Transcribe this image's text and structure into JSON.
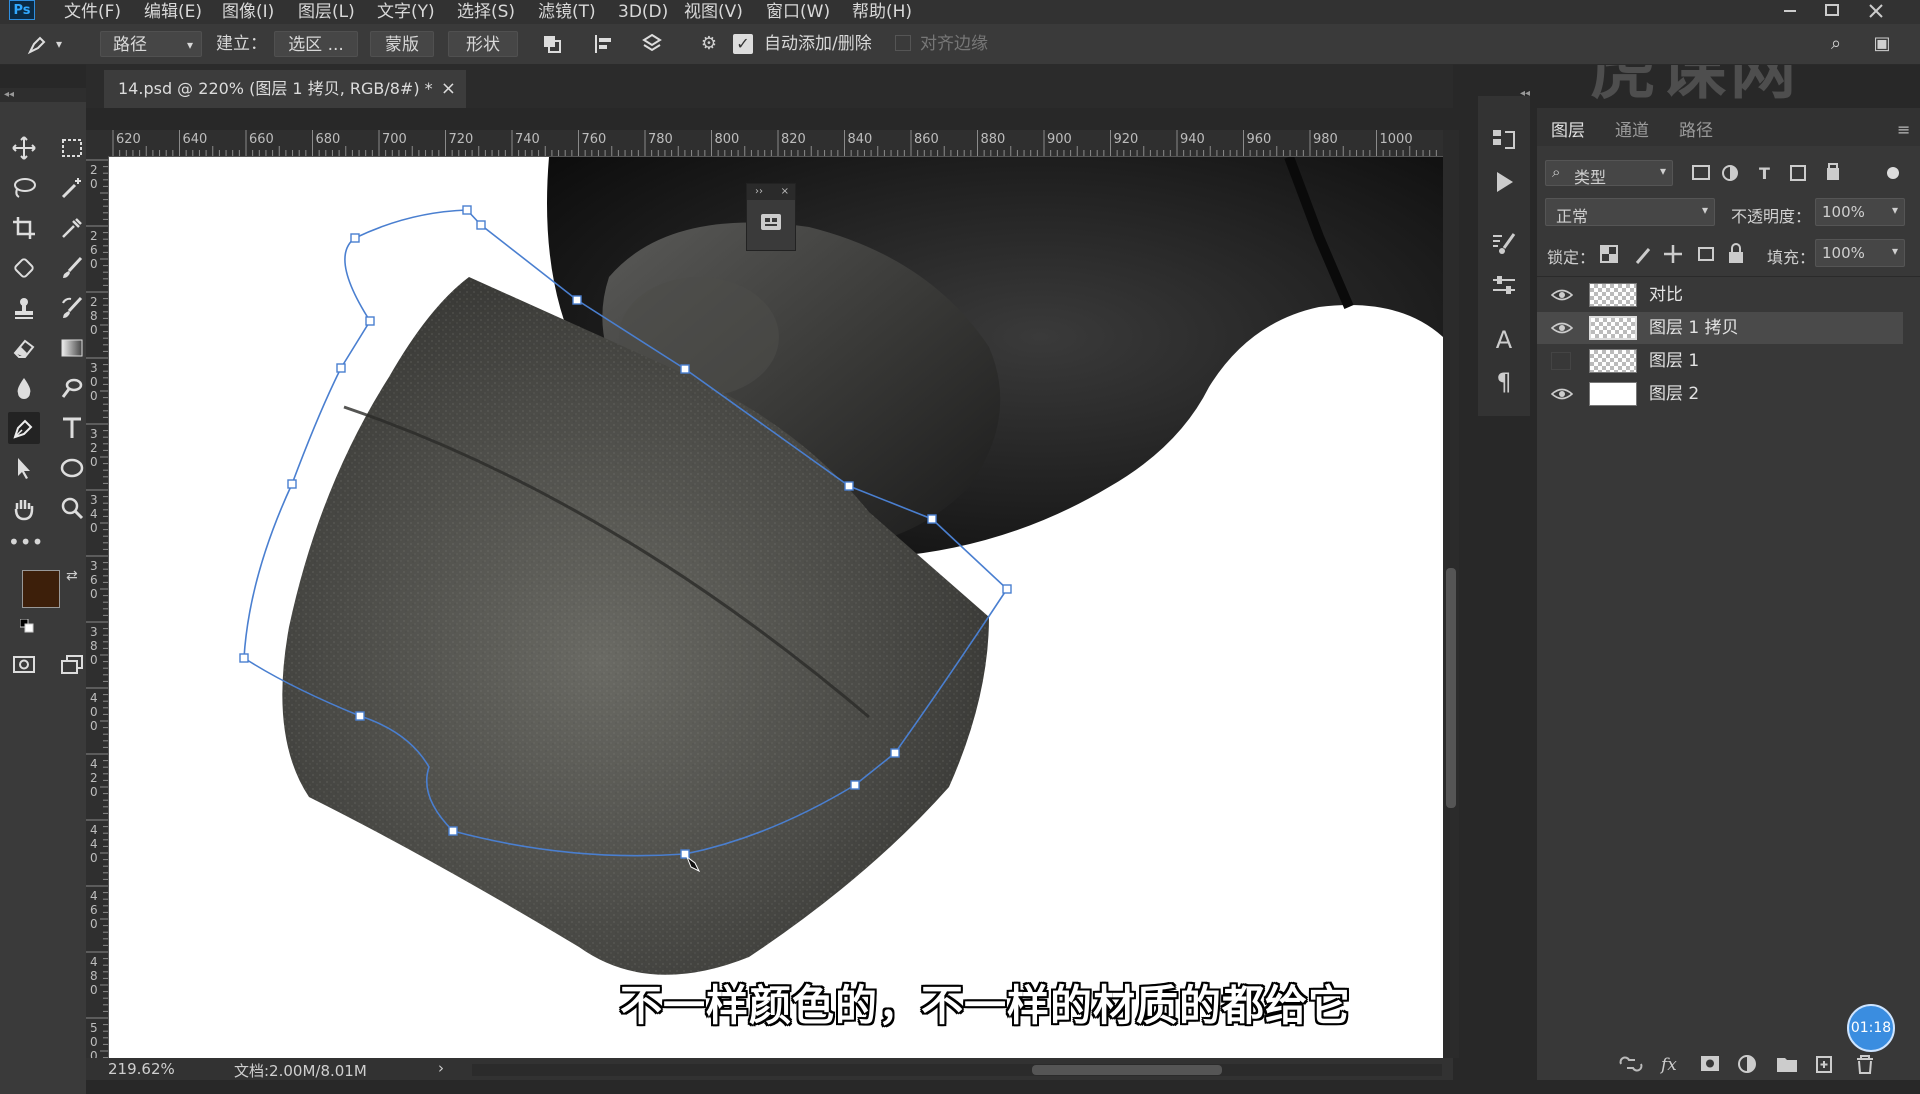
{
  "menubar": {
    "app_icon": "Ps",
    "items": [
      "文件(F)",
      "编辑(E)",
      "图像(I)",
      "图层(L)",
      "文字(Y)",
      "选择(S)",
      "滤镜(T)",
      "3D(D)",
      "视图(V)",
      "窗口(W)",
      "帮助(H)"
    ]
  },
  "options": {
    "mode_select": "路径",
    "build_label": "建立：",
    "selection_btn": "选区 ...",
    "mask_btn": "蒙版",
    "shape_btn": "形状",
    "auto_add_delete": "自动添加/删除",
    "auto_add_delete_checked": true,
    "align_edges": "对齐边缘",
    "align_edges_checked": false
  },
  "document": {
    "tab_title": "14.psd @ 220% (图层 1 拷贝, RGB/8#) *",
    "close": "×"
  },
  "ruler_top": [
    "620",
    "640",
    "660",
    "680",
    "700",
    "720",
    "740",
    "760",
    "780",
    "800",
    "820",
    "840",
    "860",
    "880",
    "900",
    "920",
    "940",
    "960",
    "980",
    "1000"
  ],
  "ruler_left": [
    "2\n0",
    "2\n6\n0",
    "2\n8\n0",
    "3\n0\n0",
    "3\n2\n0",
    "3\n4\n0",
    "3\n6\n0",
    "3\n8\n0",
    "4\n0\n0",
    "4\n2\n0",
    "4\n4\n0",
    "4\n6\n0",
    "4\n8\n0",
    "5\n0\n0"
  ],
  "status": {
    "zoom": "219.62%",
    "doc_size": "文档:2.00M/8.01M",
    "arrow": "›"
  },
  "floating_palette": {
    "expand": "››",
    "close": "×"
  },
  "layers_panel": {
    "tabs": [
      "图层",
      "通道",
      "路径"
    ],
    "active_tab": "图层",
    "filter_label": "类型",
    "blend_mode": "正常",
    "opacity_label": "不透明度：",
    "opacity_value": "100%",
    "lock_label": "锁定：",
    "fill_label": "填充：",
    "fill_value": "100%",
    "layers": [
      {
        "name": "对比",
        "visible": true,
        "selected": false
      },
      {
        "name": "图层 1 拷贝",
        "visible": true,
        "selected": true
      },
      {
        "name": "图层 1",
        "visible": false,
        "selected": false
      },
      {
        "name": "图层 2",
        "visible": true,
        "selected": false
      }
    ]
  },
  "overlay": {
    "subtitle": "不一样颜色的，不一样的材质的都给它",
    "watermark": "虎课网",
    "timer": "01:18"
  },
  "colors": {
    "foreground": "#3d1f0a",
    "background": "#ffffff",
    "path_line": "#4a7fd0",
    "accent": "#31a8ff"
  }
}
